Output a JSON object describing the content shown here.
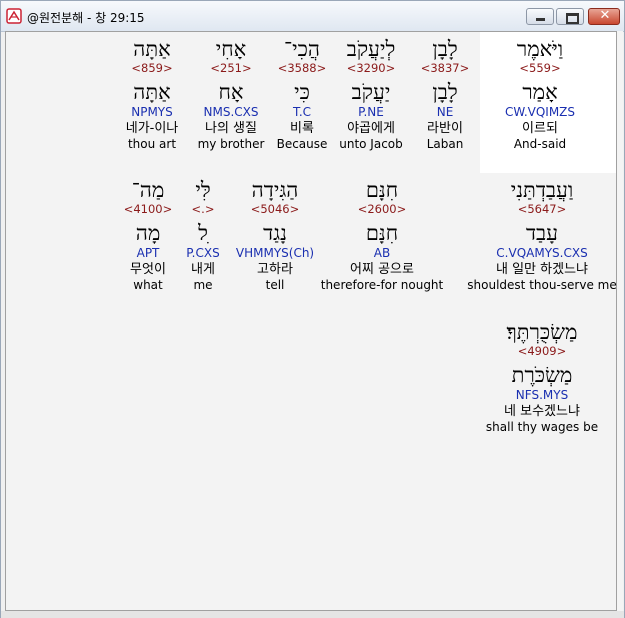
{
  "window": {
    "title": "@원전분해 - 창 29:15",
    "close_glyph": "✕"
  },
  "colors": {
    "strong": "#8b1a1a",
    "parse": "#1a2fb0",
    "highlight": "#ffffff",
    "background": "#f3f3f3"
  },
  "rows": [
    [
      {
        "heb": "וַיֹּאמֶר",
        "strong": "<559>",
        "root": "אָמַר",
        "parse": "CW.VQIMZS",
        "kor": "이르되",
        "eng": "And-said"
      },
      {
        "heb": "לָבָן",
        "strong": "<3837>",
        "root": "לָבָן",
        "parse": "NE",
        "kor": "라반이",
        "eng": "Laban"
      },
      {
        "heb": "לְיַעֲקֹב",
        "strong": "<3290>",
        "root": "יַעֲקֹב",
        "parse": "P.NE",
        "kor": "야곱에게",
        "eng": "unto Jacob"
      },
      {
        "heb": "הֲכִי־",
        "strong": "<3588>",
        "root": "כִּי",
        "parse": "T.C",
        "kor": "비록",
        "eng": "Because"
      },
      {
        "heb": "אָחִי",
        "strong": "<251>",
        "root": "אָח",
        "parse": "NMS.CXS",
        "kor": "나의 생질",
        "eng": "my brother"
      },
      {
        "heb": "אַתָּה",
        "strong": "<859>",
        "root": "אַתָּה",
        "parse": "NPMYS",
        "kor": "네가-이나",
        "eng": "thou art"
      }
    ],
    [
      {
        "heb": "וַעֲבַדְתַּנִי",
        "strong": "<5647>",
        "root": "עָבַד",
        "parse": "C.VQAMYS.CXS",
        "kor": "내 일만 하겠느냐",
        "eng": "shouldest thou-serve me"
      },
      {
        "heb": "חִנָּם",
        "strong": "<2600>",
        "root": "חִנָּם",
        "parse": "AB",
        "kor": "어찌 공으로",
        "eng": "therefore-for nought"
      },
      {
        "heb": "הַגִּידָה",
        "strong": "<5046>",
        "root": "נָגַד",
        "parse": "VHMMYS(Ch)",
        "kor": "고하라",
        "eng": "tell"
      },
      {
        "heb": "לִּי",
        "strong": "<.>",
        "root": "ִל",
        "parse": "P.CXS",
        "kor": "내게",
        "eng": "me"
      },
      {
        "heb": "מַה־",
        "strong": "<4100>",
        "root": "מָה",
        "parse": "APT",
        "kor": "무엇이",
        "eng": "what"
      }
    ],
    [
      {
        "heb": "מַשְׂכֻּרְתֶּךָ׃",
        "strong": "<4909>",
        "root": "מַשְׂכֹּרֶת",
        "parse": "NFS.MYS",
        "kor": "네 보수겠느냐",
        "eng": "shall thy wages be"
      }
    ]
  ]
}
